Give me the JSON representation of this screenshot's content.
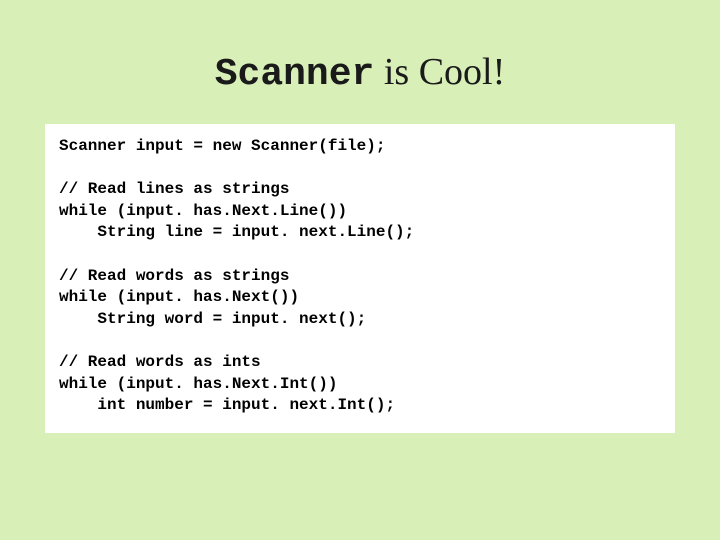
{
  "title": {
    "mono_part": "Scanner",
    "rest": " is Cool!"
  },
  "code": {
    "line1": "Scanner input = new Scanner(file);",
    "blank1": "",
    "comment1": "// Read lines as strings",
    "line2": "while (input. has.Next.Line())",
    "line3": "    String line = input. next.Line();",
    "blank2": "",
    "comment2": "// Read words as strings",
    "line4": "while (input. has.Next())",
    "line5": "    String word = input. next();",
    "blank3": "",
    "comment3": "// Read words as ints",
    "line6": "while (input. has.Next.Int())",
    "line7": "    int number = input. next.Int();"
  }
}
